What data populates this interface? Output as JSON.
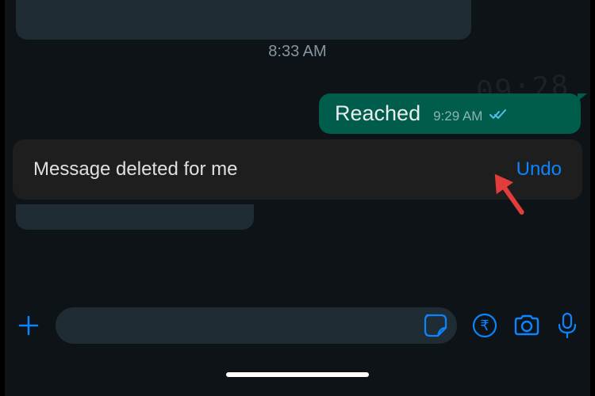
{
  "chat": {
    "time_header": "8:33 AM",
    "sent_message": {
      "text": "Reached",
      "time": "9:29 AM"
    },
    "bg_time_decor": "09:28"
  },
  "toast": {
    "message": "Message deleted for me",
    "action": "Undo"
  },
  "icons": {
    "plus": "plus-icon",
    "sticker": "sticker-icon",
    "payment": "rupee-icon",
    "camera": "camera-icon",
    "mic": "mic-icon"
  },
  "colors": {
    "accent": "#0a84ff",
    "sent_bubble": "#005c4b",
    "tick": "#53bdeb"
  }
}
